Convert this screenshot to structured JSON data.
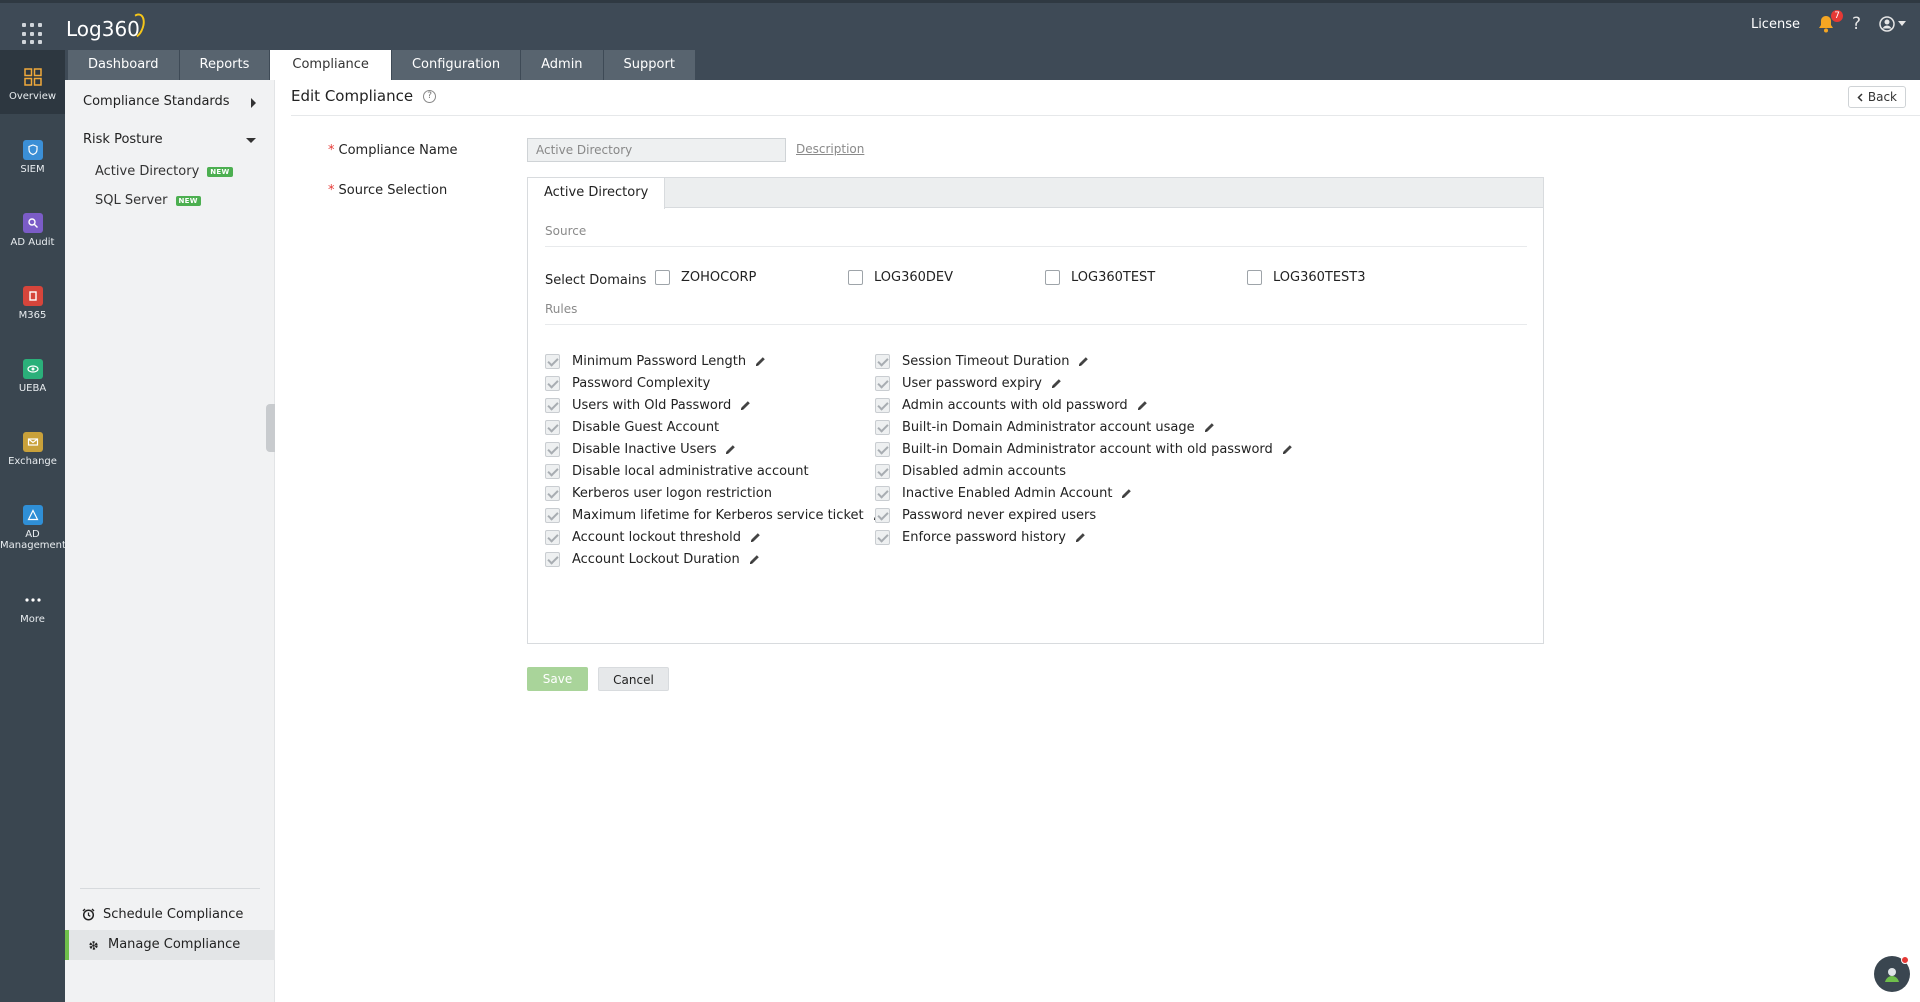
{
  "app": {
    "name": "Log360"
  },
  "header": {
    "license_label": "License",
    "notification_count": "7",
    "help_label": "?"
  },
  "tabs": [
    {
      "label": "Dashboard",
      "active": false
    },
    {
      "label": "Reports",
      "active": false
    },
    {
      "label": "Compliance",
      "active": true
    },
    {
      "label": "Configuration",
      "active": false
    },
    {
      "label": "Admin",
      "active": false
    },
    {
      "label": "Support",
      "active": false
    }
  ],
  "rail": [
    {
      "label": "Overview",
      "icon": "overview-icon",
      "color": "#f0a93b"
    },
    {
      "label": "SIEM",
      "icon": "siem-icon",
      "color": "#3b8fd6"
    },
    {
      "label": "AD Audit",
      "icon": "ad-audit-icon",
      "color": "#7b5cc7"
    },
    {
      "label": "M365",
      "icon": "m365-icon",
      "color": "#d6453b"
    },
    {
      "label": "UEBA",
      "icon": "ueba-icon",
      "color": "#2bb07a"
    },
    {
      "label": "Exchange",
      "icon": "exchange-icon",
      "color": "#c9a13a"
    },
    {
      "label": "AD",
      "label2": "Management",
      "icon": "ad-management-icon",
      "color": "#2f8fd6"
    },
    {
      "label": "More",
      "icon": "more-icon",
      "color": "#ffffff"
    }
  ],
  "sidebar": {
    "compliance_standards": "Compliance Standards",
    "risk_posture": "Risk Posture",
    "items": [
      {
        "label": "Active Directory",
        "badge": "NEW"
      },
      {
        "label": "SQL Server",
        "badge": "NEW"
      }
    ],
    "schedule": "Schedule Compliance",
    "manage": "Manage Compliance"
  },
  "page": {
    "title": "Edit Compliance",
    "back": "Back",
    "help_glyph": "?",
    "name_label": "Compliance Name",
    "name_value": "Active Directory",
    "description_link": "Description",
    "source_label": "Source Selection",
    "required_mark": "*",
    "panel_tab": "Active Directory",
    "source_heading": "Source",
    "select_domains_label": "Select Domains",
    "domains": [
      "ZOHOCORP",
      "LOG360DEV",
      "LOG360TEST",
      "LOG360TEST3"
    ],
    "rules_heading": "Rules",
    "rules_left": [
      {
        "label": "Minimum Password Length",
        "editable": true
      },
      {
        "label": "Password Complexity",
        "editable": false
      },
      {
        "label": "Users with Old Password",
        "editable": true
      },
      {
        "label": "Disable Guest Account",
        "editable": false
      },
      {
        "label": "Disable Inactive Users",
        "editable": true
      },
      {
        "label": "Disable local administrative account",
        "editable": false
      },
      {
        "label": "Kerberos user logon restriction",
        "editable": false
      },
      {
        "label": "Maximum lifetime for Kerberos service ticket",
        "editable": true
      },
      {
        "label": "Account lockout threshold",
        "editable": true
      },
      {
        "label": "Account Lockout Duration",
        "editable": true
      }
    ],
    "rules_right": [
      {
        "label": "Session Timeout Duration",
        "editable": true
      },
      {
        "label": "User password expiry",
        "editable": true
      },
      {
        "label": "Admin accounts with old password",
        "editable": true
      },
      {
        "label": "Built-in Domain Administrator account usage",
        "editable": true
      },
      {
        "label": "Built-in Domain Administrator account with old password",
        "editable": true
      },
      {
        "label": "Disabled admin accounts",
        "editable": false
      },
      {
        "label": "Inactive Enabled Admin Account",
        "editable": true
      },
      {
        "label": "Password never expired users",
        "editable": false
      },
      {
        "label": "Enforce password history",
        "editable": true
      }
    ],
    "save": "Save",
    "cancel": "Cancel"
  }
}
